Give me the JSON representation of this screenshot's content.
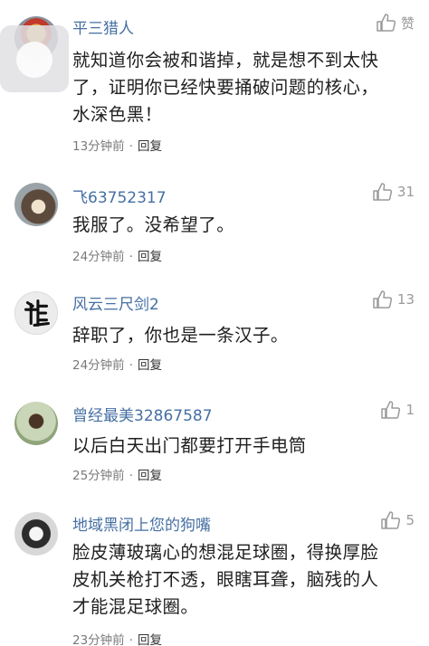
{
  "comments": [
    {
      "username": "平三猎人",
      "like_label": "赞",
      "lines": [
        "就知道你会被和谐掉，就是想不到太快",
        "了，证明你已经快要捅破问题的核心，",
        "水深色黑！"
      ],
      "time": "13分钟前",
      "reply_label": "回复"
    },
    {
      "username": "飞63752317",
      "like_label": "31",
      "lines": [
        "我服了。没希望了。"
      ],
      "time": "24分钟前",
      "reply_label": "回复"
    },
    {
      "username": "风云三尺剑2",
      "like_label": "13",
      "lines": [
        "辞职了，你也是一条汉子。"
      ],
      "time": "24分钟前",
      "reply_label": "回复"
    },
    {
      "username": "曾经最美32867587",
      "like_label": "1",
      "lines": [
        "以后白天出门都要打开手电筒"
      ],
      "time": "25分钟前",
      "reply_label": "回复"
    },
    {
      "username": "地域黑闭上您的狗嘴",
      "like_label": "5",
      "lines": [
        "脸皮薄玻璃心的想混足球圈，得换厚脸",
        "皮机关枪打不透，眼瞎耳聋，脑残的人",
        "才能混足球圈。"
      ],
      "time": "23分钟前",
      "reply_label": "回复"
    }
  ],
  "separator": "·"
}
